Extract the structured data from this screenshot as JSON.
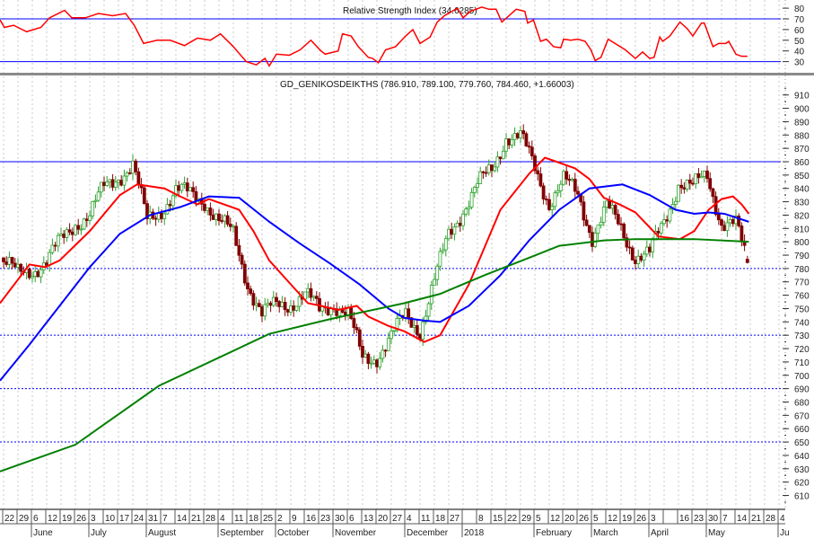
{
  "chart_data": {
    "type": "candlestick",
    "x_unit": "week index (0 = 22 May 2017)",
    "rsi_panel": {
      "title": "Relative Strength Index (34.6285)",
      "ylim": [
        20,
        85
      ],
      "y_ticks": [
        "80",
        "70",
        "60",
        "50",
        "40",
        "30"
      ],
      "levels": [
        70,
        30
      ],
      "series": [
        [
          -0.25,
          69
        ],
        [
          0.06,
          62
        ],
        [
          0.7,
          64
        ],
        [
          1.6,
          58
        ],
        [
          2.6,
          62
        ],
        [
          3.2,
          71
        ],
        [
          3.8,
          75
        ],
        [
          4.25,
          78
        ],
        [
          4.75,
          71
        ],
        [
          5.7,
          71
        ],
        [
          6.6,
          75
        ],
        [
          7.6,
          73
        ],
        [
          8.5,
          75
        ],
        [
          9.1,
          64
        ],
        [
          9.75,
          47
        ],
        [
          10.7,
          50
        ],
        [
          11.6,
          50
        ],
        [
          12.6,
          45
        ],
        [
          13.5,
          52
        ],
        [
          14.4,
          50
        ],
        [
          15.1,
          56
        ],
        [
          16,
          44
        ],
        [
          16.9,
          30
        ],
        [
          17.6,
          27
        ],
        [
          18.2,
          33
        ],
        [
          18.5,
          26
        ],
        [
          19.0,
          37
        ],
        [
          19.9,
          36
        ],
        [
          20.65,
          41
        ],
        [
          21.4,
          50
        ],
        [
          22.1,
          40
        ],
        [
          22.4,
          37
        ],
        [
          23.3,
          40
        ],
        [
          23.6,
          56
        ],
        [
          24.2,
          54
        ],
        [
          24.7,
          44
        ],
        [
          25.4,
          34
        ],
        [
          25.7,
          33
        ],
        [
          26.1,
          29
        ],
        [
          26.6,
          41
        ],
        [
          27.3,
          44
        ],
        [
          28.0,
          54
        ],
        [
          28.5,
          60
        ],
        [
          29.0,
          47
        ],
        [
          29.7,
          53
        ],
        [
          30.2,
          67
        ],
        [
          30.7,
          73
        ],
        [
          31.6,
          80
        ],
        [
          32.0,
          71
        ],
        [
          32.5,
          77
        ],
        [
          33.3,
          81
        ],
        [
          33.8,
          79
        ],
        [
          34.3,
          79
        ],
        [
          34.7,
          67
        ],
        [
          35.7,
          79
        ],
        [
          36.3,
          77
        ],
        [
          36.5,
          66
        ],
        [
          36.9,
          69
        ],
        [
          37.4,
          49
        ],
        [
          37.8,
          51
        ],
        [
          38.3,
          44
        ],
        [
          38.8,
          43
        ],
        [
          39.0,
          51
        ],
        [
          39.5,
          50
        ],
        [
          40.0,
          51
        ],
        [
          40.5,
          49
        ],
        [
          40.9,
          41
        ],
        [
          41.2,
          31
        ],
        [
          41.6,
          34
        ],
        [
          42.1,
          51
        ],
        [
          43.3,
          41
        ],
        [
          44.0,
          33
        ],
        [
          44.5,
          39
        ],
        [
          45.0,
          33
        ],
        [
          45.3,
          34
        ],
        [
          45.7,
          53
        ],
        [
          45.9,
          49
        ],
        [
          46.4,
          54
        ],
        [
          47.1,
          67
        ],
        [
          47.6,
          61
        ],
        [
          48.0,
          54
        ],
        [
          48.6,
          66
        ],
        [
          48.8,
          66
        ],
        [
          49.4,
          44
        ],
        [
          49.8,
          47
        ],
        [
          50.3,
          47
        ],
        [
          50.5,
          49
        ],
        [
          51.0,
          37
        ],
        [
          51.4,
          35
        ],
        [
          51.8,
          35
        ]
      ]
    },
    "price_panel": {
      "title": "GD_GENIKOSDEIKTHS (786.910, 789.100, 779.760, 784.460, +1.66003)",
      "ylim": [
        600,
        915
      ],
      "y_ticks": [
        "910",
        "900",
        "890",
        "880",
        "870",
        "860",
        "850",
        "840",
        "830",
        "820",
        "810",
        "800",
        "790",
        "780",
        "770",
        "760",
        "750",
        "740",
        "730",
        "720",
        "710",
        "700",
        "690",
        "680",
        "670",
        "660",
        "650",
        "640",
        "630",
        "620",
        "610"
      ],
      "solid_levels": [
        860
      ],
      "dotted_levels": [
        780,
        730,
        690,
        650
      ],
      "weekly_close": [
        [
          0,
          785
        ],
        [
          1,
          775
        ],
        [
          2,
          780
        ],
        [
          3,
          785
        ],
        [
          4,
          800
        ],
        [
          5,
          815
        ],
        [
          6,
          820
        ],
        [
          7,
          840
        ],
        [
          8,
          850
        ],
        [
          9,
          857
        ],
        [
          10,
          815
        ],
        [
          11,
          825
        ],
        [
          12,
          838
        ],
        [
          13,
          835
        ],
        [
          14,
          832
        ],
        [
          15,
          815
        ],
        [
          16,
          805
        ],
        [
          17,
          770
        ],
        [
          18,
          745
        ],
        [
          19,
          752
        ],
        [
          20,
          755
        ],
        [
          21,
          760
        ],
        [
          22,
          748
        ],
        [
          23,
          755
        ],
        [
          24,
          745
        ],
        [
          25,
          712
        ],
        [
          26,
          715
        ],
        [
          27,
          728
        ],
        [
          28,
          745
        ],
        [
          29,
          735
        ],
        [
          30,
          770
        ],
        [
          31,
          805
        ],
        [
          32,
          825
        ],
        [
          33,
          842
        ],
        [
          34,
          853
        ],
        [
          35,
          880
        ],
        [
          36,
          878
        ],
        [
          37,
          855
        ],
        [
          38,
          830
        ],
        [
          39,
          845
        ],
        [
          40,
          835
        ],
        [
          41,
          805
        ],
        [
          42,
          825
        ],
        [
          43,
          810
        ],
        [
          44,
          790
        ],
        [
          45,
          790
        ],
        [
          46,
          815
        ],
        [
          47,
          845
        ],
        [
          48,
          840
        ],
        [
          49,
          850
        ],
        [
          50,
          815
        ],
        [
          51,
          812
        ],
        [
          51.8,
          784
        ]
      ],
      "last_candle": {
        "open": 786.91,
        "high": 789.1,
        "low": 779.76,
        "close": 784.46,
        "change": 1.66003
      },
      "moving_averages": [
        {
          "name": "MA short",
          "color": "#ff0000",
          "points": [
            [
              -0.25,
              754
            ],
            [
              1.8,
              783
            ],
            [
              2.9,
              781
            ],
            [
              3.9,
              786
            ],
            [
              6,
              808
            ],
            [
              8.1,
              835
            ],
            [
              9.3,
              843
            ],
            [
              11.2,
              840
            ],
            [
              12.3,
              834
            ],
            [
              13.5,
              828
            ],
            [
              14.3,
              832
            ],
            [
              16.4,
              824
            ],
            [
              17.4,
              808
            ],
            [
              18.5,
              786
            ],
            [
              20.6,
              761
            ],
            [
              21.2,
              754
            ],
            [
              22.1,
              752
            ],
            [
              23.3,
              749
            ],
            [
              24.6,
              752
            ],
            [
              25.4,
              744
            ],
            [
              26.8,
              737
            ],
            [
              27.9,
              733
            ],
            [
              29.3,
              725
            ],
            [
              30.4,
              730
            ],
            [
              32.4,
              768
            ],
            [
              34.6,
              824
            ],
            [
              36.6,
              851
            ],
            [
              37.7,
              863
            ],
            [
              38.5,
              860
            ],
            [
              39.8,
              855
            ],
            [
              40.8,
              847
            ],
            [
              41.8,
              833
            ],
            [
              42.9,
              828
            ],
            [
              44,
              822
            ],
            [
              45.6,
              804
            ],
            [
              47.1,
              802
            ],
            [
              48.1,
              808
            ],
            [
              49.1,
              824
            ],
            [
              50,
              832
            ],
            [
              50.8,
              834
            ],
            [
              51.4,
              828
            ],
            [
              51.9,
              821
            ]
          ]
        },
        {
          "name": "MA medium",
          "color": "#0000ff",
          "points": [
            [
              -0.25,
              696
            ],
            [
              1.8,
              723
            ],
            [
              3.9,
              752
            ],
            [
              6,
              781
            ],
            [
              8.1,
              806
            ],
            [
              10.2,
              820
            ],
            [
              12.3,
              826
            ],
            [
              14.3,
              834
            ],
            [
              16.4,
              833
            ],
            [
              18.5,
              815
            ],
            [
              20.6,
              799
            ],
            [
              22.7,
              784
            ],
            [
              24.8,
              768
            ],
            [
              26.8,
              750
            ],
            [
              27.9,
              743
            ],
            [
              29.3,
              741
            ],
            [
              30.4,
              740
            ],
            [
              32.4,
              752
            ],
            [
              34.6,
              775
            ],
            [
              36.6,
              801
            ],
            [
              38.7,
              824
            ],
            [
              40.8,
              840
            ],
            [
              43.1,
              843
            ],
            [
              45,
              835
            ],
            [
              46.8,
              824
            ],
            [
              48.1,
              821
            ],
            [
              49.1,
              822
            ],
            [
              50.2,
              821
            ],
            [
              51.9,
              815
            ]
          ]
        },
        {
          "name": "MA long",
          "color": "#008000",
          "points": [
            [
              -0.25,
              628
            ],
            [
              5,
              648
            ],
            [
              10.8,
              692
            ],
            [
              18.5,
              731
            ],
            [
              22.7,
              742
            ],
            [
              27.9,
              754
            ],
            [
              30.4,
              761
            ],
            [
              33.5,
              775
            ],
            [
              36.6,
              788
            ],
            [
              38.7,
              797
            ],
            [
              41.8,
              801
            ],
            [
              44,
              802
            ],
            [
              48.1,
              802
            ],
            [
              51.9,
              800
            ]
          ]
        }
      ]
    },
    "x_ticks": [
      "22",
      "29",
      "6",
      "12",
      "19",
      "26",
      "3",
      "10",
      "17",
      "24",
      "31",
      "7",
      "14",
      "21",
      "28",
      "4",
      "11",
      "18",
      "25",
      "2",
      "9",
      "16",
      "23",
      "30",
      "6",
      "13",
      "20",
      "27",
      "4",
      "11",
      "18",
      "27",
      "",
      "8",
      "15",
      "22",
      "29",
      "5",
      "12",
      "20",
      "26",
      "5",
      "12",
      "19",
      "26",
      "3",
      "",
      "16",
      "23",
      "30",
      "7",
      "14",
      "21",
      "28",
      "4"
    ],
    "month_labels": [
      {
        "label": "June",
        "tick": 2
      },
      {
        "label": "July",
        "tick": 6
      },
      {
        "label": "August",
        "tick": 10
      },
      {
        "label": "September",
        "tick": 15
      },
      {
        "label": "October",
        "tick": 19
      },
      {
        "label": "November",
        "tick": 23
      },
      {
        "label": "December",
        "tick": 28
      },
      {
        "label": "2018",
        "tick": 32
      },
      {
        "label": "February",
        "tick": 37
      },
      {
        "label": "March",
        "tick": 41
      },
      {
        "label": "April",
        "tick": 45
      },
      {
        "label": "May",
        "tick": 49
      },
      {
        "label": "Ju",
        "tick": 54
      }
    ],
    "colors": {
      "up": "#2ca02c",
      "down": "#800000",
      "rsi": "#ff0000",
      "level": "#0000ff",
      "grid": "#c8c8c8"
    }
  }
}
